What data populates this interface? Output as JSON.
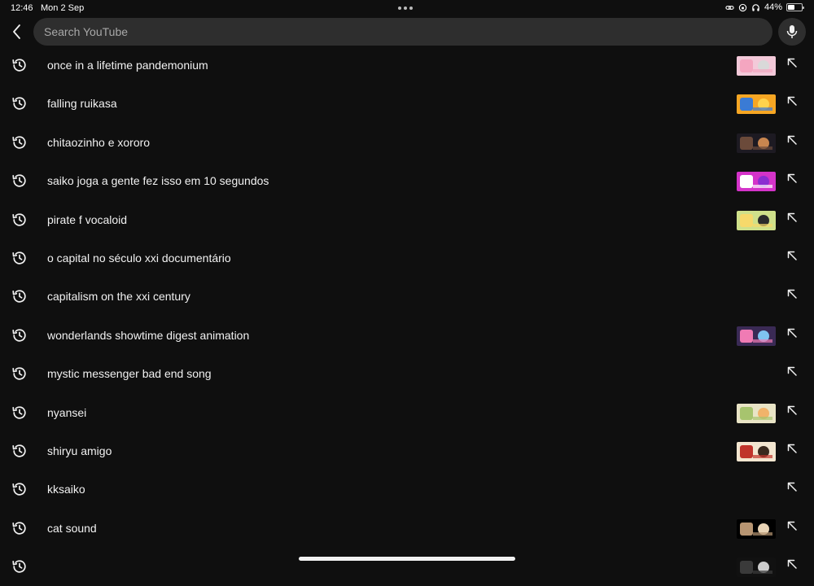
{
  "status_bar": {
    "time": "12:46",
    "date": "Mon 2 Sep",
    "battery_text": "44%",
    "battery_level": 0.44
  },
  "search": {
    "placeholder": "Search YouTube",
    "value": ""
  },
  "history": [
    {
      "label": "once in a lifetime pandemonium",
      "thumb": {
        "bg": "#f3c9d9",
        "a": "#f4a6c0",
        "b": "#d9d9d9"
      }
    },
    {
      "label": "falling ruikasa",
      "thumb": {
        "bg": "#f6a623",
        "a": "#3a7bd5",
        "b": "#ffd34d"
      }
    },
    {
      "label": "chitaozinho e xororo",
      "thumb": {
        "bg": "#1d1a22",
        "a": "#6b4a3a",
        "b": "#c9864f"
      }
    },
    {
      "label": "saiko joga a gente fez isso em 10 segundos",
      "thumb": {
        "bg": "#d433c9",
        "a": "#ffffff",
        "b": "#8b2dd1"
      }
    },
    {
      "label": "pirate f vocaloid",
      "thumb": {
        "bg": "#cfe08a",
        "a": "#f6d96b",
        "b": "#2b2b2b"
      }
    },
    {
      "label": "o capital no século xxi documentário",
      "thumb": null
    },
    {
      "label": "capitalism on the xxi century",
      "thumb": null
    },
    {
      "label": "wonderlands showtime digest animation",
      "thumb": {
        "bg": "#3a2a55",
        "a": "#f07bb4",
        "b": "#7fc4f0"
      }
    },
    {
      "label": "mystic messenger bad end song",
      "thumb": null
    },
    {
      "label": "nyansei",
      "thumb": {
        "bg": "#e9e4c6",
        "a": "#a7c46e",
        "b": "#f1b36a"
      }
    },
    {
      "label": "shiryu amigo",
      "thumb": {
        "bg": "#f3e6d0",
        "a": "#c0342b",
        "b": "#3a2a1e"
      }
    },
    {
      "label": "kksaiko",
      "thumb": null
    },
    {
      "label": "cat sound",
      "thumb": {
        "bg": "#000000",
        "a": "#b79572",
        "b": "#e8d3b5"
      }
    },
    {
      "label": "",
      "thumb": {
        "bg": "#111111",
        "a": "#3a3a3a",
        "b": "#cccccc"
      }
    }
  ],
  "icons": {
    "back": "chevron-left-icon",
    "mic": "microphone-icon",
    "history": "history-clock-icon",
    "fill_query": "arrow-up-left-icon"
  }
}
